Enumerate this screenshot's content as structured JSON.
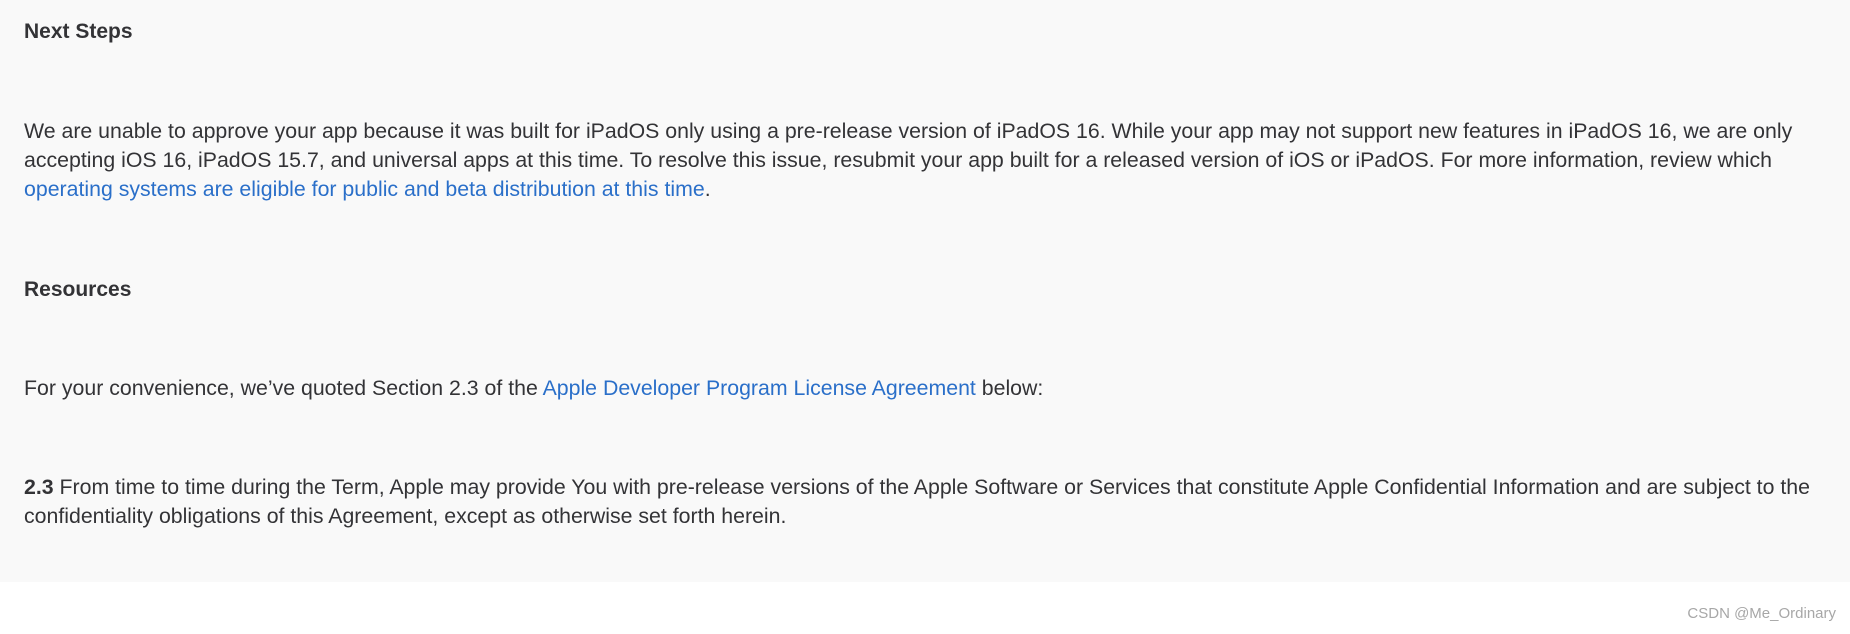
{
  "next_steps": {
    "heading": "Next Steps",
    "body_text": "We are unable to approve your app because it was built for iPadOS only using a pre-release version of iPadOS 16. While your app may not support new features in iPadOS 16, we are only accepting iOS 16, iPadOS 15.7, and universal apps at this time. To resolve this issue, resubmit your app built for a released version of iOS or iPadOS. For more information, review which ",
    "link_text": "operating systems are eligible for public and beta distribution at this time",
    "body_end": "."
  },
  "resources": {
    "heading": "Resources",
    "intro_text": "For your convenience, we’ve quoted Section 2.3 of the ",
    "link_text": "Apple Developer Program License Agreement",
    "intro_end": " below:",
    "section_number": "2.3",
    "section_text": " From time to time during the Term, Apple may provide You with pre-release versions of the Apple Software or Services that constitute Apple Confidential Information and are subject to the confidentiality obligations of this Agreement, except as otherwise set forth herein."
  },
  "watermark": "CSDN @Me_Ordinary",
  "colors": {
    "background_panel": "#f9f9f9",
    "text": "#333336",
    "link": "#2a6fc9"
  }
}
